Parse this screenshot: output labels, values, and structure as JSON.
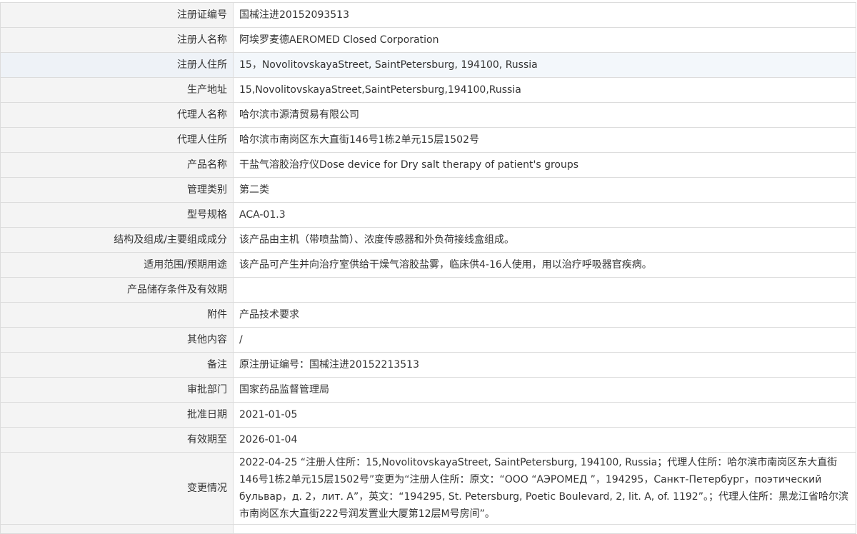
{
  "rows": [
    {
      "label": "注册证编号",
      "value": "国械注进20152093513"
    },
    {
      "label": "注册人名称",
      "value": "阿埃罗麦德AEROMED Closed Corporation"
    },
    {
      "label": "注册人住所",
      "value": "15，NovolitovskayaStreet, SaintPetersburg, 194100, Russia"
    },
    {
      "label": "生产地址",
      "value": "15,NovolitovskayaStreet,SaintPetersburg,194100,Russia"
    },
    {
      "label": "代理人名称",
      "value": "哈尔滨市源清贸易有限公司"
    },
    {
      "label": "代理人住所",
      "value": "哈尔滨市南岗区东大直街146号1栋2单元15层1502号"
    },
    {
      "label": "产品名称",
      "value": "干盐气溶胶治疗仪Dose device for Dry salt therapy of patient's groups"
    },
    {
      "label": "管理类别",
      "value": "第二类"
    },
    {
      "label": "型号规格",
      "value": "ACA-01.3"
    },
    {
      "label": "结构及组成/主要组成成分",
      "value": "该产品由主机（带喷盐筒）、浓度传感器和外负荷接线盒组成。"
    },
    {
      "label": "适用范围/预期用途",
      "value": "该产品可产生并向治疗室供给干燥气溶胶盐雾，临床供4-16人使用，用以治疗呼吸器官疾病。"
    },
    {
      "label": "产品储存条件及有效期",
      "value": ""
    },
    {
      "label": "附件",
      "value": "产品技术要求"
    },
    {
      "label": "其他内容",
      "value": "/"
    },
    {
      "label": "备注",
      "value": "原注册证编号：国械注进20152213513"
    },
    {
      "label": "审批部门",
      "value": "国家药品监督管理局"
    },
    {
      "label": "批准日期",
      "value": "2021-01-05"
    },
    {
      "label": "有效期至",
      "value": "2026-01-04"
    },
    {
      "label": "变更情况",
      "value": "2022-04-25 “注册人住所：15,NovolitovskayaStreet, SaintPetersburg, 194100, Russia；代理人住所：哈尔滨市南岗区东大直街146号1栋2单元15层1502号”变更为“注册人住所：原文：“ООО “АЭРОМЕД ”，194295，Санкт-Петербург，поэтический бульвар，д. 2，лит. А”，英文：“194295, St. Petersburg, Poetic Boulevard, 2, lit. A, of. 1192”。；代理人住所：黑龙江省哈尔滨市南岗区东大直街222号润发置业大厦第12层M号房间”。"
    }
  ]
}
